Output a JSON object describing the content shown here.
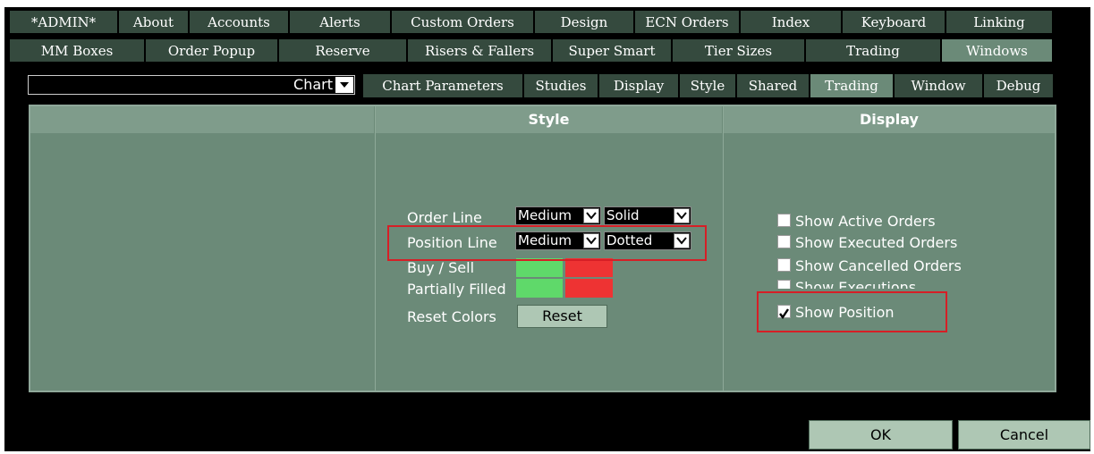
{
  "top_tabs_row1": [
    "*ADMIN*",
    "About",
    "Accounts",
    "Alerts",
    "Custom Orders",
    "Design",
    "ECN Orders",
    "Index",
    "Keyboard",
    "Linking"
  ],
  "top_tabs_row2": [
    "MM Boxes",
    "Order Popup",
    "Reserve",
    "Risers & Fallers",
    "Super Smart",
    "Tier Sizes",
    "Trading",
    "Windows"
  ],
  "window_select": {
    "value": "Chart"
  },
  "sub_tabs": [
    "Chart Parameters",
    "Studies",
    "Display",
    "Style",
    "Shared",
    "Trading",
    "Window",
    "Debug"
  ],
  "style_section": {
    "header": "Style",
    "order_line": {
      "label": "Order Line",
      "width": "Medium",
      "style": "Solid"
    },
    "position_line": {
      "label": "Position Line",
      "width": "Medium",
      "style": "Dotted"
    },
    "buy_sell_label": "Buy / Sell",
    "partially_filled_label": "Partially Filled",
    "reset_colors_label": "Reset Colors",
    "reset_button": "Reset",
    "colors": {
      "buy": "#5fd96a",
      "sell": "#ee3333"
    }
  },
  "display_section": {
    "header": "Display",
    "options": [
      {
        "label": "Show Active Orders",
        "checked": false
      },
      {
        "label": "Show Executed Orders",
        "checked": false
      },
      {
        "label": "Show Cancelled Orders",
        "checked": false
      },
      {
        "label": "Show Executions",
        "checked": false
      },
      {
        "label": "Show Position",
        "checked": true
      }
    ]
  },
  "footer": {
    "ok": "OK",
    "cancel": "Cancel"
  }
}
